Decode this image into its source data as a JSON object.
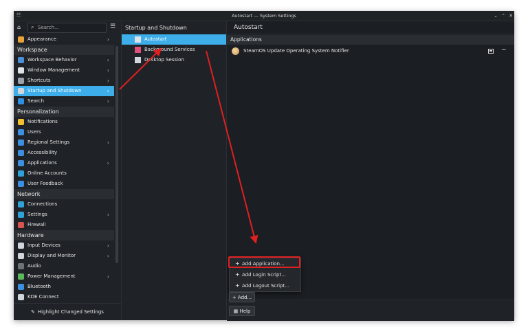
{
  "window": {
    "title": "Autostart — System Settings"
  },
  "sidebar": {
    "search_placeholder": "Search...",
    "items": [
      {
        "type": "item",
        "label": "Appearance",
        "chevron": true,
        "color": "#e9a23b"
      },
      {
        "type": "section",
        "label": "Workspace"
      },
      {
        "type": "item",
        "label": "Workspace Behavior",
        "chevron": true,
        "color": "#4a8fd8"
      },
      {
        "type": "item",
        "label": "Window Management",
        "chevron": true,
        "color": "#dfe3e8"
      },
      {
        "type": "item",
        "label": "Shortcuts",
        "chevron": true,
        "color": "#9aa3ad"
      },
      {
        "type": "item",
        "label": "Startup and Shutdown",
        "chevron": true,
        "active": true,
        "color": "#cfd6dd"
      },
      {
        "type": "item",
        "label": "Search",
        "chevron": true,
        "color": "#2f8fe0"
      },
      {
        "type": "section",
        "label": "Personalization"
      },
      {
        "type": "item",
        "label": "Notifications",
        "chevron": false,
        "color": "#f3c12b"
      },
      {
        "type": "item",
        "label": "Users",
        "chevron": false,
        "color": "#3d8fe0"
      },
      {
        "type": "item",
        "label": "Regional Settings",
        "chevron": true,
        "color": "#3d8fe0"
      },
      {
        "type": "item",
        "label": "Accessibility",
        "chevron": false,
        "color": "#3d8fe0"
      },
      {
        "type": "item",
        "label": "Applications",
        "chevron": true,
        "color": "#3d8fe0"
      },
      {
        "type": "item",
        "label": "Online Accounts",
        "chevron": false,
        "color": "#2fa2d8"
      },
      {
        "type": "item",
        "label": "User Feedback",
        "chevron": false,
        "color": "#3d8fe0"
      },
      {
        "type": "section",
        "label": "Network"
      },
      {
        "type": "item",
        "label": "Connections",
        "chevron": false,
        "color": "#2fa2d8"
      },
      {
        "type": "item",
        "label": "Settings",
        "chevron": true,
        "color": "#2fa2d8"
      },
      {
        "type": "item",
        "label": "Firewall",
        "chevron": false,
        "color": "#d9534f"
      },
      {
        "type": "section",
        "label": "Hardware"
      },
      {
        "type": "item",
        "label": "Input Devices",
        "chevron": true,
        "color": "#cfd6dd"
      },
      {
        "type": "item",
        "label": "Display and Monitor",
        "chevron": true,
        "color": "#cfd6dd"
      },
      {
        "type": "item",
        "label": "Audio",
        "chevron": false,
        "color": "#6c7378"
      },
      {
        "type": "item",
        "label": "Power Management",
        "chevron": true,
        "color": "#5cb85c"
      },
      {
        "type": "item",
        "label": "Bluetooth",
        "chevron": false,
        "color": "#3d8fe0"
      },
      {
        "type": "item",
        "label": "KDE Connect",
        "chevron": false,
        "color": "#cfd6dd"
      }
    ],
    "highlight_label": "Highlight Changed Settings"
  },
  "middle": {
    "title": "Startup and Shutdown",
    "items": [
      {
        "label": "Autostart",
        "active": true,
        "color": "#dfe3e8"
      },
      {
        "label": "Background Services",
        "active": false,
        "color": "#e0507a"
      },
      {
        "label": "Desktop Session",
        "active": false,
        "color": "#cfd6dd"
      }
    ]
  },
  "main": {
    "title": "Autostart",
    "section": "Applications",
    "entries": [
      {
        "label": "SteamOS Update Operating System Notifier"
      }
    ],
    "menu": [
      "Add Application...",
      "Add Login Script...",
      "Add Logout Script..."
    ],
    "add_label": "Add...",
    "help_label": "Help"
  },
  "colors": {
    "accent": "#3daee9",
    "annotation": "#e02020"
  }
}
